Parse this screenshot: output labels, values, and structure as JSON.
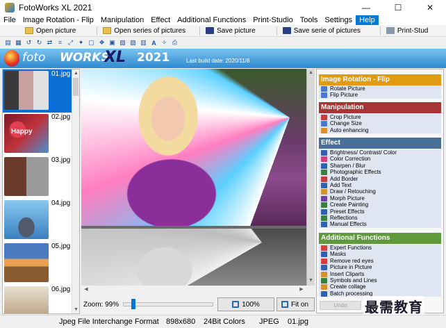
{
  "window": {
    "title": "FotoWorks XL 2021",
    "minimize": "—",
    "maximize": "☐",
    "close": "✕"
  },
  "menu": [
    "File",
    "Image Rotation - Flip",
    "Manipulation",
    "Effect",
    "Additional Functions",
    "Print-Studio",
    "Tools",
    "Settings",
    "Help"
  ],
  "toolbar": {
    "open_picture": "Open picture",
    "open_series": "Open series of pictures",
    "save_picture": "Save picture",
    "save_series": "Save serie of pictures",
    "print_studio": "Print-Stud"
  },
  "icons": [
    "folder-icon",
    "folder-icon",
    "rotate-left-icon",
    "rotate-right-icon",
    "flip-icon",
    "crop-icon",
    "resize-icon",
    "effect-icon",
    "border-icon",
    "clipart-icon",
    "frame-icon",
    "picture-icon",
    "picture-icon",
    "grid-icon",
    "text-icon",
    "magic-icon",
    "print-icon"
  ],
  "banner": {
    "logo_part1": "foto",
    "logo_part2": "WORKS",
    "logo_xl": "XL",
    "logo_year": "2021",
    "build_date": "Last build date: 2020/11/8"
  },
  "thumbnails": [
    {
      "label": "01.jpg",
      "selected": true
    },
    {
      "label": "02.jpg",
      "selected": false
    },
    {
      "label": "03.jpg",
      "selected": false
    },
    {
      "label": "04.jpg",
      "selected": false
    },
    {
      "label": "05.jpg",
      "selected": false
    },
    {
      "label": "06.jpg",
      "selected": false
    }
  ],
  "thumb_text": "Happy",
  "zoom": {
    "label": "Zoom: 99%",
    "value_percent": 99,
    "hundred_button": "100%",
    "fit_button": "Fit on"
  },
  "panel": {
    "rotation": {
      "title": "Image Rotation - Flip",
      "color": "#e09b10",
      "items": [
        "Rotate Picture",
        "Flip Picture"
      ]
    },
    "manipulation": {
      "title": "Manipulation",
      "color": "#a83535",
      "items": [
        "Crop Picture",
        "Change Size",
        "Auto enhancing"
      ]
    },
    "effect": {
      "title": "Effect",
      "color": "#4a6f96",
      "items": [
        "Brightness/ Contrast/ Color",
        "Color Correction",
        "Sharpen / Blur",
        "Photographic Effects",
        "Add Border",
        "Add Text",
        "Draw / Retouching",
        "Morph Picture",
        "Create Painting",
        "Preset Effects",
        "Reflections",
        "Manual Effects"
      ]
    },
    "additional": {
      "title": "Additional Functions",
      "color": "#5f9a3a",
      "items": [
        "Expert Functions",
        "Masks",
        "Remove red eyes",
        "Picture in Picture",
        "Insert Cliparts",
        "Symbols and Lines",
        "Create collage",
        "Batch processing"
      ]
    },
    "undo": "Undo"
  },
  "watermark": "最需教育",
  "status": {
    "format": "Jpeg File Interchange Format",
    "dimensions": "898x680",
    "color_depth": "24Bit Colors",
    "type": "JPEG",
    "filename": "01.jpg"
  }
}
